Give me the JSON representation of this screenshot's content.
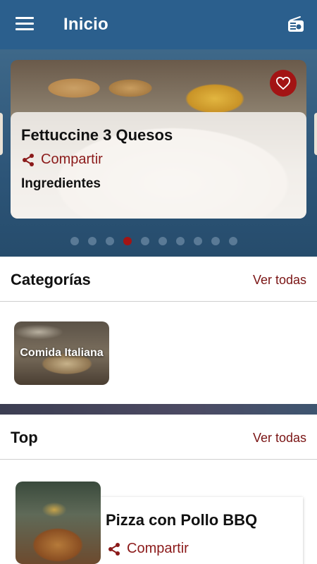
{
  "appbar": {
    "title": "Inicio",
    "menu_icon": "menu-icon",
    "radio_icon": "radio-icon"
  },
  "featured": {
    "title": "Fettuccine 3 Quesos",
    "share_label": "Compartir",
    "ingredients_label": "Ingredientes",
    "favorite_icon": "heart-icon",
    "dots_total": 10,
    "active_dot": 4
  },
  "categories": {
    "heading": "Categorías",
    "more_label": "Ver todas",
    "items": [
      {
        "label": "Comida Italiana"
      }
    ]
  },
  "top": {
    "heading": "Top",
    "more_label": "Ver todas",
    "items": [
      {
        "name": "Pizza con Pollo BBQ",
        "share_label": "Compartir"
      }
    ]
  },
  "colors": {
    "appbar": "#2b5f8d",
    "accent": "#a31414",
    "link": "#7a1414"
  }
}
